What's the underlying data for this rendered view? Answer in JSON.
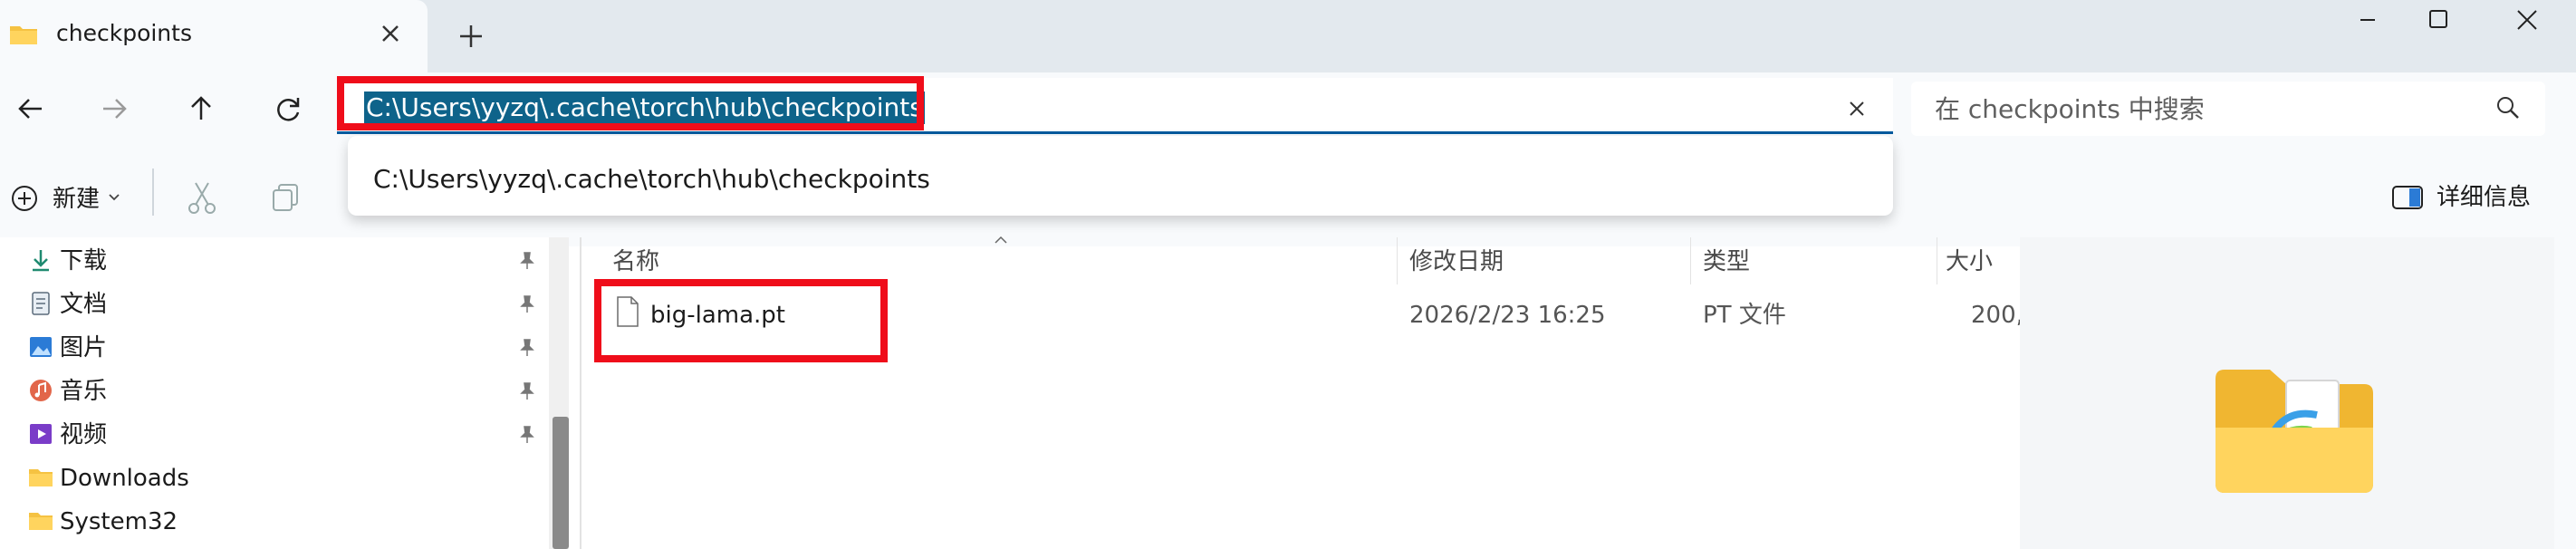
{
  "window": {
    "tab_title": "checkpoints"
  },
  "address_bar": {
    "path": "C:\\Users\\yyzq\\.cache\\torch\\hub\\checkpoints",
    "suggestion": "C:\\Users\\yyzq\\.cache\\torch\\hub\\checkpoints"
  },
  "search": {
    "placeholder": "在 checkpoints 中搜索"
  },
  "commands": {
    "new_label": "新建",
    "details_label": "详细信息"
  },
  "sidebar": {
    "items": [
      {
        "label": "下载",
        "icon": "download-icon",
        "pinned": true
      },
      {
        "label": "文档",
        "icon": "document-icon",
        "pinned": true
      },
      {
        "label": "图片",
        "icon": "picture-icon",
        "pinned": true
      },
      {
        "label": "音乐",
        "icon": "music-icon",
        "pinned": true
      },
      {
        "label": "视频",
        "icon": "video-icon",
        "pinned": true
      },
      {
        "label": "Downloads",
        "icon": "folder-icon",
        "pinned": false
      },
      {
        "label": "System32",
        "icon": "folder-icon",
        "pinned": false
      }
    ]
  },
  "file_list": {
    "columns": [
      "名称",
      "修改日期",
      "类型",
      "大小"
    ],
    "rows": [
      {
        "name": "big-lama.pt",
        "modified": "2026/2/23 16:25",
        "type": "PT 文件",
        "size": "200,"
      }
    ]
  },
  "colors": {
    "highlight": "#ef0d1a",
    "selection": "#0e638a",
    "accent": "#005a9e"
  }
}
